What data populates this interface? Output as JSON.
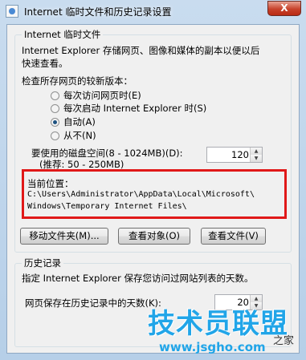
{
  "window": {
    "title": "Internet 临时文件和历史记录设置",
    "close_label": "X"
  },
  "temp_files": {
    "legend": "Internet 临时文件",
    "description_line1": "Internet Explorer 存储网页、图像和媒体的副本以便以后",
    "description_line2": "快速查看。",
    "check_label": "检查所存网页的较新版本：",
    "options": [
      {
        "label": "每次访问网页时(E)",
        "checked": false
      },
      {
        "label": "每次启动 Internet Explorer 时(S)",
        "checked": false
      },
      {
        "label": "自动(A)",
        "checked": true
      },
      {
        "label": "从不(N)",
        "checked": false
      }
    ],
    "disk_space_label": "要使用的磁盘空间(8 - 1024MB)(D):",
    "disk_space_hint": "(推荐: 50 - 250MB)",
    "disk_space_value": "120",
    "location_label": "当前位置：",
    "location_path_line1": "C:\\Users\\Administrator\\AppData\\Local\\Microsoft\\",
    "location_path_line2": "Windows\\Temporary Internet Files\\",
    "buttons": {
      "move_folder": "移动文件夹(M)...",
      "view_objects": "查看对象(O)",
      "view_files": "查看文件(V)"
    }
  },
  "history": {
    "legend": "历史记录",
    "description": "指定 Internet Explorer 保存您访问过网站列表的天数。",
    "days_label": "网页保存在历史记录中的天数(K):",
    "days_value": "20"
  },
  "watermark": {
    "logo_text": "技术员联盟",
    "url": "www.jsgho.com",
    "tail": "之家"
  }
}
